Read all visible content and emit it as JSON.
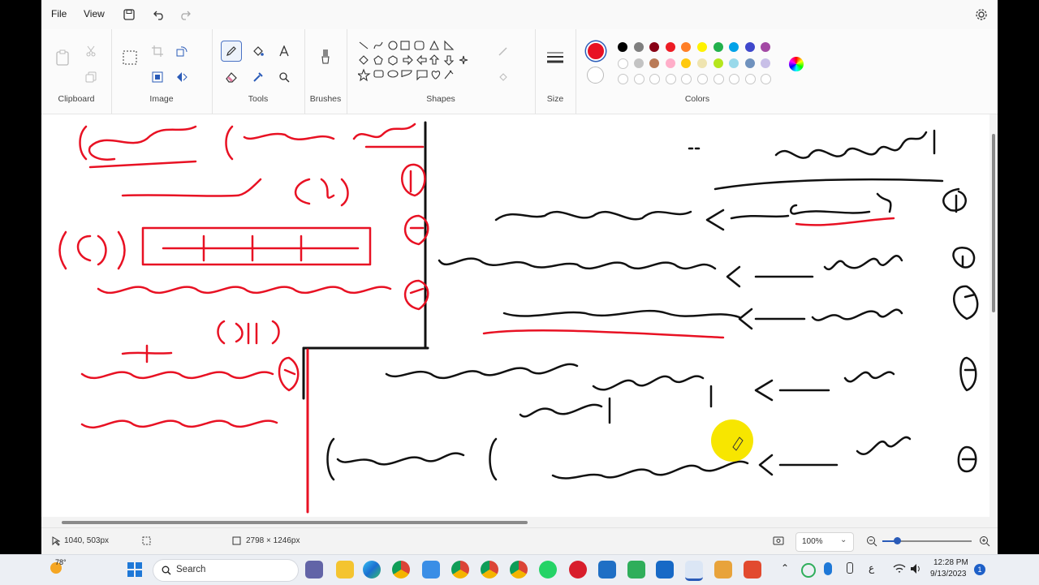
{
  "menu": {
    "file": "File",
    "view": "View"
  },
  "ribbon": {
    "clipboard_label": "Clipboard",
    "image_label": "Image",
    "tools_label": "Tools",
    "brushes_label": "Brushes",
    "shapes_label": "Shapes",
    "size_label": "Size",
    "colors_label": "Colors"
  },
  "colors": {
    "primary": "#e81123",
    "row1": [
      "#000000",
      "#7f7f7f",
      "#880015",
      "#ed1c24",
      "#ff7f27",
      "#fff200",
      "#22b14c",
      "#00a2e8",
      "#3f48cc",
      "#a349a4"
    ],
    "row2": [
      "#ffffff",
      "#c3c3c3",
      "#b97a57",
      "#ffaec9",
      "#ffc90e",
      "#efe4b0",
      "#b5e61d",
      "#99d9ea",
      "#7092be",
      "#c8bfe7"
    ]
  },
  "status": {
    "cursor_pos": "1040, 503px",
    "canvas_size": "2798 × 1246px",
    "zoom": "100%"
  },
  "taskbar": {
    "weather_temp": "78°",
    "search_placeholder": "Search",
    "time": "12:28 PM",
    "date": "9/13/2023",
    "notifications": "1",
    "lang": "ع"
  }
}
